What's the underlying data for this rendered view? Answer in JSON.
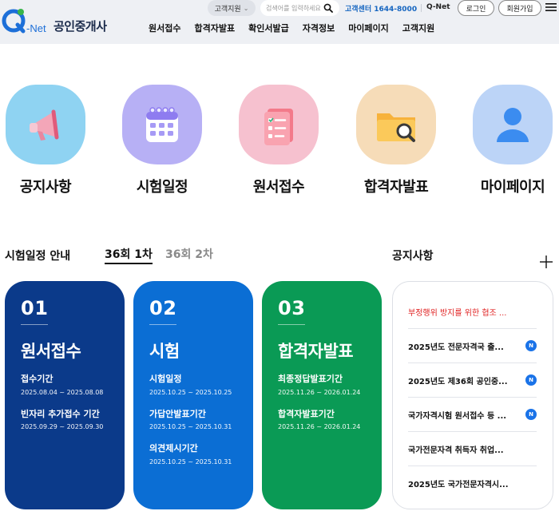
{
  "header": {
    "logo_q": "Q",
    "logo_net": "-Net",
    "site_name": "공인중개사",
    "cs_dropdown": "고객지원",
    "search_placeholder": "검색어를 입력하세요",
    "cs_center": "고객센터 1644-8000",
    "qnet_link": "Q-Net",
    "login_label": "로그인",
    "join_label": "회원가입",
    "nav": [
      "원서접수",
      "합격자발표",
      "확인서발급",
      "자격정보",
      "마이페이지",
      "고객지원"
    ]
  },
  "quick_menu": [
    {
      "label": "공지사항",
      "icon": "megaphone-icon",
      "bg": "#8fd3f2"
    },
    {
      "label": "시험일정",
      "icon": "calendar-icon",
      "bg": "#b7b0f5"
    },
    {
      "label": "원서접수",
      "icon": "checklist-icon",
      "bg": "#f6c1cf"
    },
    {
      "label": "합격자발표",
      "icon": "folder-search-icon",
      "bg": "#f6dcb8"
    },
    {
      "label": "마이페이지",
      "icon": "user-icon",
      "bg": "#bcd4f7"
    }
  ],
  "schedule": {
    "title": "시험일정 안내",
    "tabs": [
      "36회 1차",
      "36회 2차"
    ],
    "cards": [
      {
        "num": "01",
        "title": "원서접수",
        "items": [
          {
            "label": "접수기간",
            "date": "2025.08.04 ~ 2025.08.08"
          },
          {
            "label": "빈자리 추가접수 기간",
            "date": "2025.09.29 ~ 2025.09.30"
          }
        ]
      },
      {
        "num": "02",
        "title": "시험",
        "items": [
          {
            "label": "시험일정",
            "date": "2025.10.25 ~ 2025.10.25"
          },
          {
            "label": "가답안발표기간",
            "date": "2025.10.25 ~ 2025.10.31"
          },
          {
            "label": "의견제시기간",
            "date": "2025.10.25 ~ 2025.10.31"
          }
        ]
      },
      {
        "num": "03",
        "title": "합격자발표",
        "items": [
          {
            "label": "최종정답발표기간",
            "date": "2025.11.26 ~ 2026.01.24"
          },
          {
            "label": "합격자발표기간",
            "date": "2025.11.26 ~ 2026.01.24"
          }
        ]
      }
    ]
  },
  "notices": {
    "title": "공지사항",
    "badge_label": "N",
    "items": [
      {
        "text": "부정행위 방지를 위한 협조 ...",
        "new": false,
        "highlight": true
      },
      {
        "text": "2025년도 전문자격국 출...",
        "new": true,
        "highlight": false
      },
      {
        "text": "2025년도 제36회 공인중...",
        "new": true,
        "highlight": false
      },
      {
        "text": "국가자격시험 원서접수 등 ...",
        "new": true,
        "highlight": false
      },
      {
        "text": "국가전문자격 취득자 취업...",
        "new": false,
        "highlight": false
      },
      {
        "text": "2025년도 국가전문자격시...",
        "new": false,
        "highlight": false
      }
    ]
  },
  "colors": {
    "card1": "#0b3a8a",
    "card2": "#0b6ed4",
    "card3": "#0a9a55",
    "notice_highlight": "#e02020",
    "badge": "#1a73e8"
  }
}
